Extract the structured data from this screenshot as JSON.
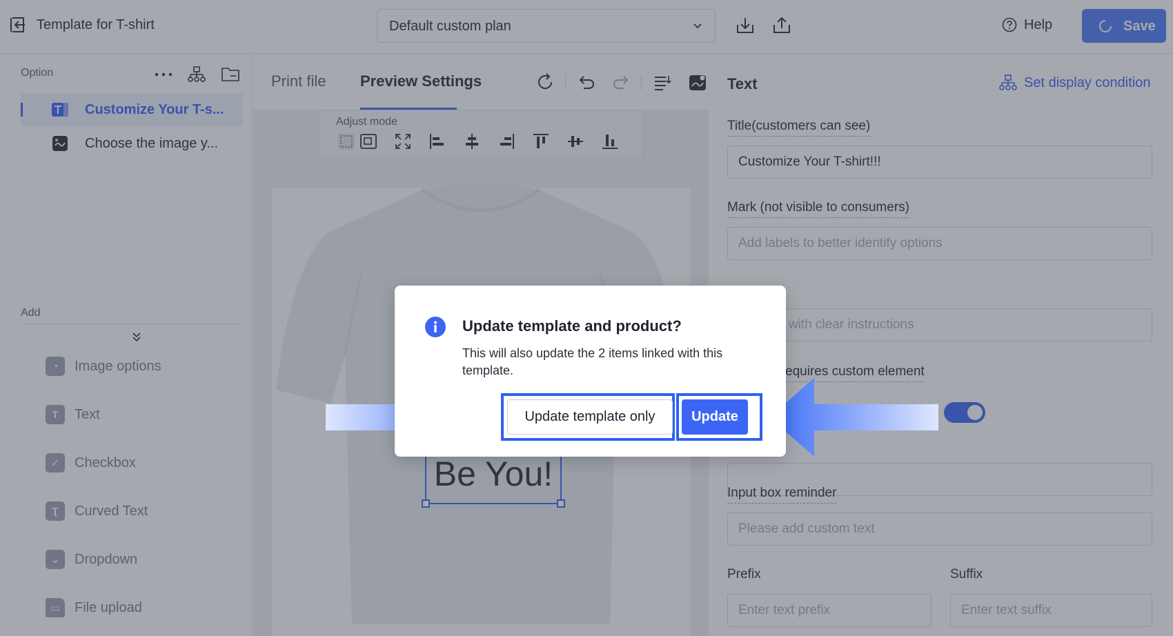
{
  "header": {
    "title": "Template for T-shirt",
    "plan_value": "Default custom plan",
    "help_label": "Help",
    "save_label": "Save"
  },
  "left": {
    "option_label": "Option",
    "options": [
      {
        "label": "Customize Your T-s...",
        "icon": "text-icon",
        "active": true
      },
      {
        "label": "Choose the image y...",
        "icon": "image-icon",
        "active": false
      }
    ],
    "add_label": "Add",
    "add_items": [
      {
        "label": "Image options",
        "icon": "image-options-icon"
      },
      {
        "label": "Text",
        "icon": "text-icon"
      },
      {
        "label": "Checkbox",
        "icon": "checkbox-icon"
      },
      {
        "label": "Curved Text",
        "icon": "curved-text-icon"
      },
      {
        "label": "Dropdown",
        "icon": "dropdown-icon"
      },
      {
        "label": "File upload",
        "icon": "folder-icon"
      }
    ]
  },
  "center": {
    "tabs": [
      {
        "label": "Print file",
        "active": false
      },
      {
        "label": "Preview Settings",
        "active": true
      }
    ],
    "adjust_mode_label": "Adjust mode",
    "preview_text": "Be You!"
  },
  "right": {
    "title": "Text",
    "display_condition_label": "Set display condition",
    "title_field_label": "Title(customers can see)",
    "title_field_value": "Customize Your T-shirt!!!",
    "mark_label": "Mark (not visible to consumers)",
    "mark_placeholder": "Add labels to better identify options",
    "note_placeholder_partial": "stomers with clear instructions",
    "requires_label_partial": "equires custom element",
    "input_reminder_label": "Input box reminder",
    "input_reminder_placeholder": "Please add custom text",
    "prefix_label": "Prefix",
    "prefix_placeholder": "Enter text prefix",
    "suffix_label": "Suffix",
    "suffix_placeholder": "Enter text suffix"
  },
  "dialog": {
    "title": "Update template and product?",
    "message": "This will also update the 2 items linked with this template.",
    "secondary_label": "Update template only",
    "primary_label": "Update"
  },
  "colors": {
    "accent": "#3b66f5",
    "highlight": "#2f62f0",
    "overlay": "#383d4b"
  }
}
